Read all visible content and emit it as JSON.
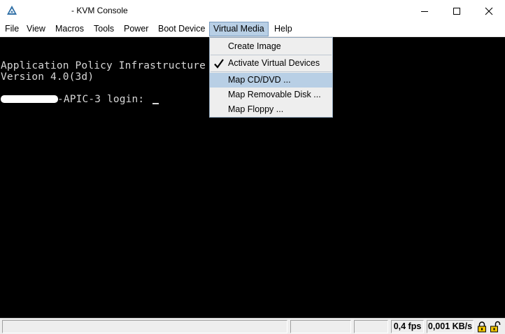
{
  "window": {
    "title": "- KVM Console",
    "icon": "kvm-app-icon"
  },
  "menubar": {
    "items": [
      "File",
      "View",
      "Macros",
      "Tools",
      "Power",
      "Boot Device",
      "Virtual Media",
      "Help"
    ],
    "active": "Virtual Media"
  },
  "virtual_media_menu": {
    "items": [
      {
        "label": "Create Image",
        "checked": false
      },
      {
        "label": "Activate Virtual Devices",
        "checked": true
      },
      {
        "label": "Map CD/DVD ...",
        "highlighted": true
      },
      {
        "label": "Map Removable Disk ..."
      },
      {
        "label": "Map Floppy ..."
      }
    ]
  },
  "console": {
    "line1": "Application Policy Infrastructure",
    "line2": "Version 4.0(3d)",
    "login_suffix": "-APIC-3 login: ",
    "text_color": "#d8d8d8",
    "background": "#000000"
  },
  "statusbar": {
    "fps": "0,4 fps",
    "rate": "0,001 KB/s"
  },
  "colors": {
    "menu_highlight": "#b8cfe5",
    "menu_bg": "#eeeeee",
    "accent": "#2f6fa6"
  }
}
